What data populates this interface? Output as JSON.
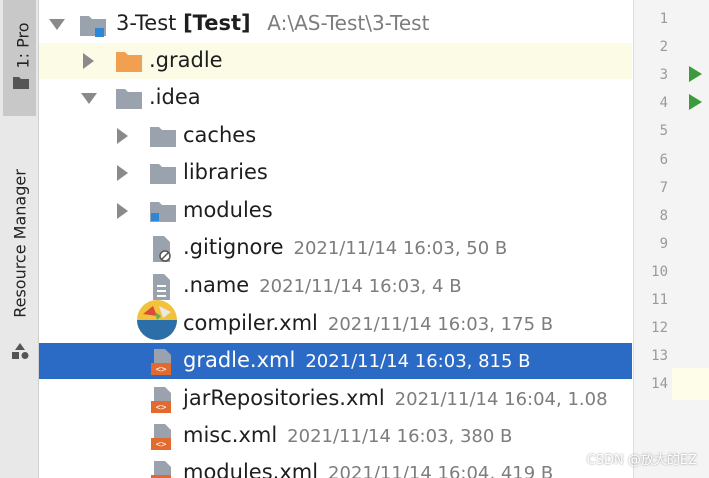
{
  "side_tabs": {
    "project": "1: Pro",
    "resource_manager": "Resource Manager"
  },
  "tree": {
    "root": {
      "name": "3-Test",
      "module": "[Test]",
      "path": "A:\\AS-Test\\3-Test"
    },
    "rows": [
      {
        "label": ".gradle"
      },
      {
        "label": ".idea"
      },
      {
        "label": "caches"
      },
      {
        "label": "libraries"
      },
      {
        "label": "modules"
      },
      {
        "label": ".gitignore",
        "meta": "2021/11/14 16:03, 50 B"
      },
      {
        "label": ".name",
        "meta": "2021/11/14 16:03, 4 B"
      },
      {
        "label": "compiler.xml",
        "meta": "2021/11/14 16:03, 175 B"
      },
      {
        "label": "gradle.xml",
        "meta": "2021/11/14 16:03, 815 B"
      },
      {
        "label": "jarRepositories.xml",
        "meta": "2021/11/14 16:04, 1.08"
      },
      {
        "label": "misc.xml",
        "meta": "2021/11/14 16:03, 380 B"
      },
      {
        "label": "modules.xml",
        "meta": "2021/11/14 16:04, 419 B"
      }
    ]
  },
  "gutter": {
    "lines": [
      "1",
      "2",
      "3",
      "4",
      "5",
      "6",
      "7",
      "8",
      "9",
      "10",
      "11",
      "12",
      "13",
      "14"
    ]
  },
  "watermark": "CSDN @放大的EZ",
  "colors": {
    "selection": "#2b6bc6",
    "folder": "#9aa3ad",
    "gradle_folder": "#f0a050",
    "run": "#3c9a3c"
  }
}
